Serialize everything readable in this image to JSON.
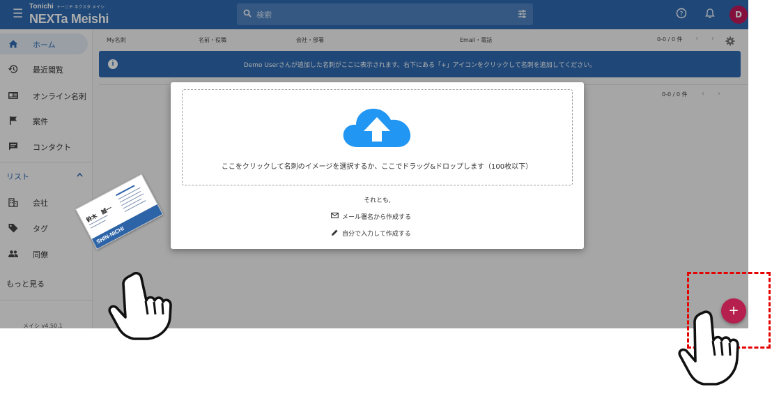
{
  "header": {
    "logo_small": "Tonichi",
    "logo_small_kana": "トーニチ ネクスタ メイシ",
    "logo_big": "NEXTa Meishi",
    "search_placeholder": "検索",
    "avatar_letter": "D"
  },
  "sidebar": {
    "items": [
      {
        "label": "ホーム",
        "icon": "home-icon"
      },
      {
        "label": "最近閲覧",
        "icon": "history-icon"
      },
      {
        "label": "オンライン名刺",
        "icon": "id-card-icon"
      },
      {
        "label": "案件",
        "icon": "flag-icon"
      },
      {
        "label": "コンタクト",
        "icon": "chat-icon"
      }
    ],
    "list_header": "リスト",
    "list_items": [
      {
        "label": "会社",
        "icon": "building-icon"
      },
      {
        "label": "タグ",
        "icon": "tag-icon"
      },
      {
        "label": "同僚",
        "icon": "people-icon"
      }
    ],
    "more": "もっと見る",
    "version": "メイシ v4.50.1"
  },
  "main": {
    "columns": [
      "My名刺",
      "名前・役職",
      "会社・部署",
      "Email・電話"
    ],
    "pager_top": "0-0 / 0 件",
    "pager_second": "0-0 / 0 件",
    "info_text": "Demo Userさんが追加した名刺がここに表示されます。右下にある「+」アイコンをクリックして名刺を追加してください。"
  },
  "dialog": {
    "drop_text": "ここをクリックして名刺のイメージを選択するか、ここでドラッグ&ドロップします（100枚以下）",
    "or_text": "それとも,",
    "option_email": "メール署名から作成する",
    "option_manual": "自分で入力して作成する"
  },
  "fab": {
    "label": "+"
  },
  "card": {
    "name": "鈴木　誠一",
    "band_text": "SHIN-NICHI"
  },
  "colors": {
    "header": "#2f6bb3",
    "fab": "#b5204e",
    "cloud": "#2196f3",
    "highlight": "#e50000"
  }
}
